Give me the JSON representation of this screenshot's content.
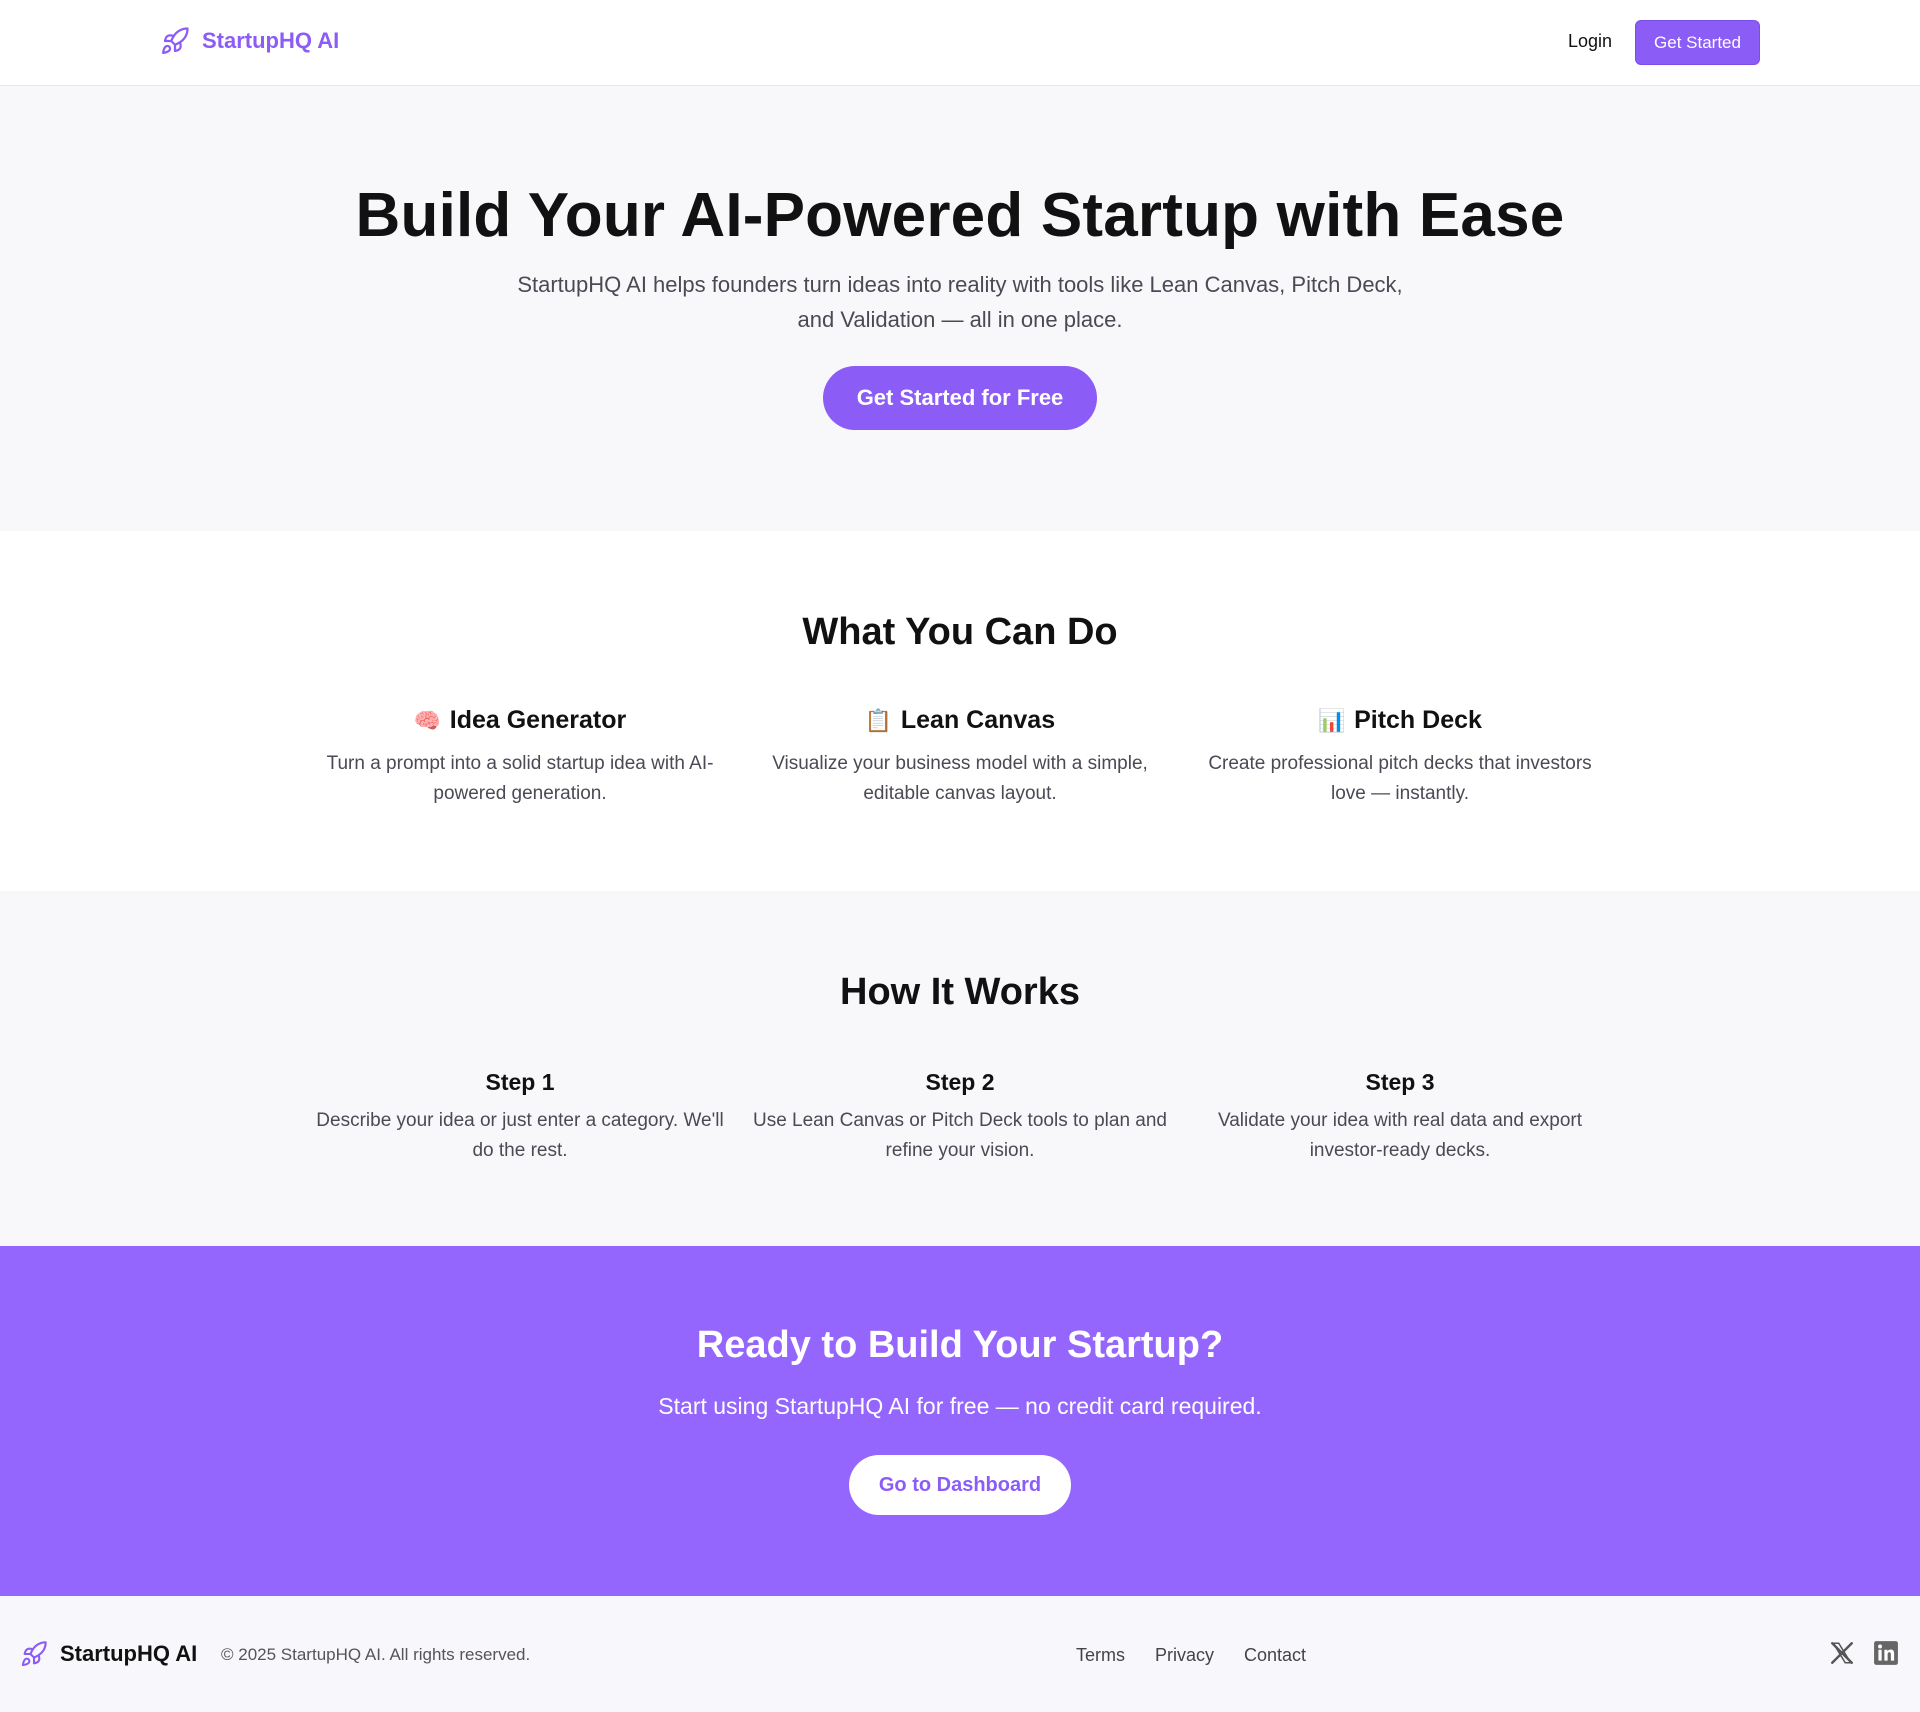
{
  "nav": {
    "brand": "StartupHQ AI",
    "login": "Login",
    "get_started": "Get Started"
  },
  "hero": {
    "title": "Build Your AI-Powered Startup with Ease",
    "subtitle": "StartupHQ AI helps founders turn ideas into reality with tools like Lean Canvas, Pitch Deck, and Validation — all in one place.",
    "cta": "Get Started for Free"
  },
  "features": {
    "title": "What You Can Do",
    "items": [
      {
        "icon": "brain-icon",
        "emoji": "🧠",
        "title": "Idea Generator",
        "text": "Turn a prompt into a solid startup idea with AI-powered generation."
      },
      {
        "icon": "clipboard-icon",
        "emoji": "📋",
        "title": "Lean Canvas",
        "text": "Visualize your business model with a simple, editable canvas layout."
      },
      {
        "icon": "bar-chart-icon",
        "emoji": "📊",
        "title": "Pitch Deck",
        "text": "Create professional pitch decks that investors love — instantly."
      }
    ]
  },
  "how": {
    "title": "How It Works",
    "steps": [
      {
        "title": "Step 1",
        "text": "Describe your idea or just enter a category. We'll do the rest."
      },
      {
        "title": "Step 2",
        "text": "Use Lean Canvas or Pitch Deck tools to plan and refine your vision."
      },
      {
        "title": "Step 3",
        "text": "Validate your idea with real data and export investor-ready decks."
      }
    ]
  },
  "cta": {
    "title": "Ready to Build Your Startup?",
    "text": "Start using StartupHQ AI for free — no credit card required.",
    "button": "Go to Dashboard"
  },
  "footer": {
    "brand": "StartupHQ AI",
    "copyright": "© 2025 StartupHQ AI. All rights reserved.",
    "links": [
      "Terms",
      "Privacy",
      "Contact"
    ],
    "social": [
      "x-icon",
      "linkedin-icon"
    ]
  },
  "colors": {
    "brand": "#8b5cf6",
    "cta_band": "#9466fd",
    "light_bg": "#f8f8fa"
  }
}
